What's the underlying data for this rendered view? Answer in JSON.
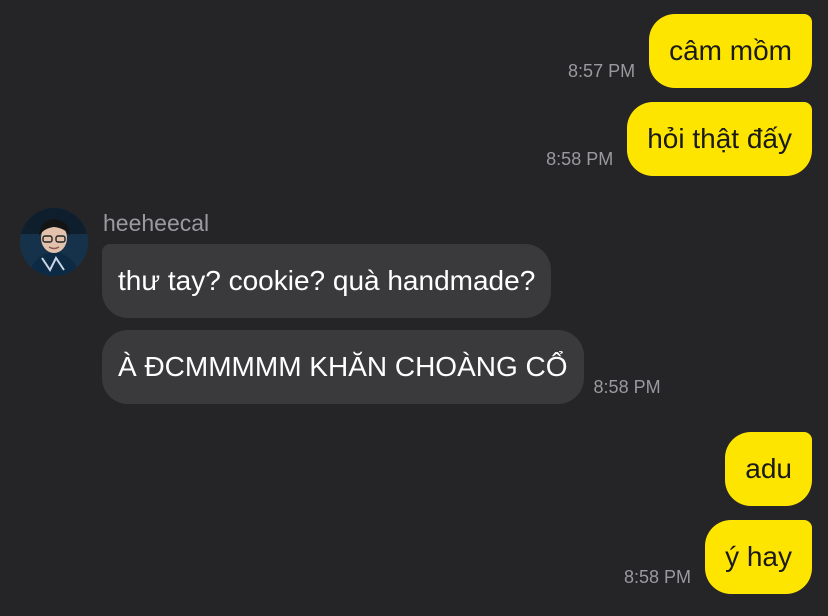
{
  "conversation": {
    "sender_name": "heeheecal",
    "messages": [
      {
        "from": "me",
        "text": "câm mồm",
        "time": "8:57 PM"
      },
      {
        "from": "me",
        "text": "hỏi thật đấy",
        "time": "8:58 PM"
      },
      {
        "from": "heeheecal",
        "text": "thư tay? cookie? quà handmade?",
        "time": ""
      },
      {
        "from": "heeheecal",
        "text": "À ĐCMMMMM KHĂN CHOÀNG CỔ",
        "time": "8:58 PM"
      },
      {
        "from": "me",
        "text": "adu",
        "time": ""
      },
      {
        "from": "me",
        "text": "ý hay",
        "time": "8:58 PM"
      }
    ]
  },
  "colors": {
    "background": "#252527",
    "my_bubble": "#fee500",
    "their_bubble": "#3a3a3c",
    "timestamp": "#9a9a9e"
  }
}
